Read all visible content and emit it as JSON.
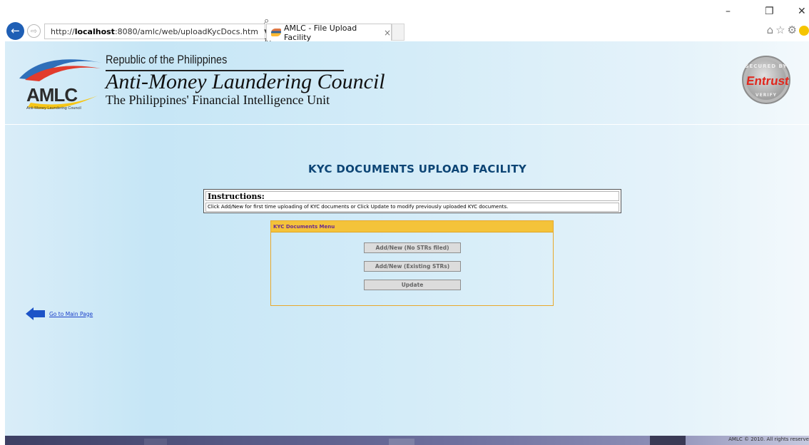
{
  "browser": {
    "url_prefix": "http://",
    "url_host": "localhost",
    "url_rest": ":8080/amlc/web/uploadKycDocs.htm",
    "search_icon": "search-icon",
    "refresh_icon": "refresh-icon",
    "tab_title": "AMLC - File Upload Facility",
    "tab_close": "×",
    "min": "–",
    "restore": "❐",
    "close": "✕",
    "back_glyph": "←",
    "fwd_glyph": "⇨",
    "tools_glyphs": "⌂☆⚙"
  },
  "header": {
    "logo_text": "AMLC",
    "logo_sub": "Anti-Money Laundering Council",
    "republic": "Republic of the Philippines",
    "council": "Anti-Money Laundering Council",
    "fiu": "The Philippines' Financial Intelligence Unit",
    "seal_top": "SECURED BY",
    "seal_name": "Entrust",
    "seal_bottom": "VERIFY"
  },
  "main": {
    "title": "KYC DOCUMENTS UPLOAD FACILITY",
    "instructions_label": "Instructions:",
    "instructions_text": "Click Add/New for first time uploading of KYC documents or Click Update to modify previously uploaded KYC documents.",
    "menu_title": "KYC Documents Menu",
    "buttons": [
      {
        "label": "Add/New (No STRs filed)"
      },
      {
        "label": "Add/New (Existing STRs)"
      },
      {
        "label": "Update"
      }
    ],
    "go_main_label": "Go to Main Page"
  },
  "footer": {
    "copyright": "AMLC © 2010. All rights reserve"
  },
  "colors": {
    "title": "#0d4575",
    "menu_header": "#f4c33a",
    "menu_title_text": "#6a2a8e",
    "link": "#1a3fc9",
    "arrow": "#1c53c7"
  }
}
